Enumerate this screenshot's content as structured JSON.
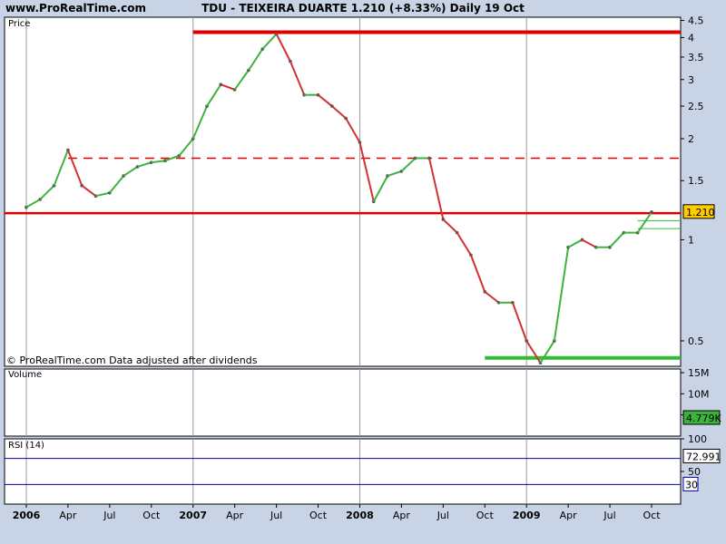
{
  "header": {
    "site": "www.ProRealTime.com",
    "title": "TDU - TEIXEIRA DUARTE    1.210 (+8.33%)   Daily  19 Oct"
  },
  "price_panel": {
    "label": "Price",
    "footnote": "© ProRealTime.com  Data adjusted after dividends",
    "last_price_box": "1.210",
    "y_ticks": [
      "4.5",
      "4",
      "3.5",
      "3",
      "2.5",
      "2",
      "1.5",
      "1",
      "0.5"
    ]
  },
  "volume_panel": {
    "label": "Volume",
    "y_ticks": [
      "15M",
      "10M",
      "5M"
    ],
    "last_volume_box": "4.779K"
  },
  "rsi_panel": {
    "label": "RSI (14)",
    "y_ticks": [
      "100",
      "50"
    ],
    "last_rsi_box": "72.991",
    "lower_level_box": "30"
  },
  "x_axis": {
    "labels": [
      {
        "t": "2006",
        "bold": true
      },
      {
        "t": "Apr",
        "bold": false
      },
      {
        "t": "Jul",
        "bold": false
      },
      {
        "t": "Oct",
        "bold": false
      },
      {
        "t": "2007",
        "bold": true
      },
      {
        "t": "Apr",
        "bold": false
      },
      {
        "t": "Jul",
        "bold": false
      },
      {
        "t": "Oct",
        "bold": false
      },
      {
        "t": "2008",
        "bold": true
      },
      {
        "t": "Apr",
        "bold": false
      },
      {
        "t": "Jul",
        "bold": false
      },
      {
        "t": "Oct",
        "bold": false
      },
      {
        "t": "2009",
        "bold": true
      },
      {
        "t": "Apr",
        "bold": false
      },
      {
        "t": "Jul",
        "bold": false
      },
      {
        "t": "Oct",
        "bold": false
      }
    ]
  },
  "colors": {
    "background": "#c8d4e6",
    "panel": "#ffffff",
    "up": "#3cb43c",
    "down": "#d23232",
    "resistance": "#dd0000",
    "support": "#33bb33",
    "rsi_line": "#000000",
    "rsi_band": "#0000aa",
    "price_box": "#ffcc00"
  },
  "chart_data": {
    "type": "line",
    "title": "TDU - TEIXEIRA DUARTE",
    "y_scale": "log",
    "ylim": [
      0.42,
      4.6
    ],
    "series": [
      {
        "x": [
          "2006-01",
          "2006-02",
          "2006-03",
          "2006-04",
          "2006-05",
          "2006-06",
          "2006-07",
          "2006-08",
          "2006-09",
          "2006-10",
          "2006-11",
          "2006-12",
          "2007-01",
          "2007-02",
          "2007-03",
          "2007-04",
          "2007-05",
          "2007-06",
          "2007-07",
          "2007-08",
          "2007-09",
          "2007-10",
          "2007-11",
          "2007-12",
          "2008-01",
          "2008-02",
          "2008-03",
          "2008-04",
          "2008-05",
          "2008-06",
          "2008-07",
          "2008-08",
          "2008-09",
          "2008-10",
          "2008-11",
          "2008-12",
          "2009-01",
          "2009-02",
          "2009-03",
          "2009-04",
          "2009-05",
          "2009-06",
          "2009-07",
          "2009-08",
          "2009-09",
          "2009-10"
        ],
        "y": [
          1.25,
          1.32,
          1.45,
          1.85,
          1.45,
          1.35,
          1.38,
          1.55,
          1.65,
          1.7,
          1.72,
          1.78,
          2.0,
          2.5,
          2.9,
          2.8,
          3.2,
          3.7,
          4.1,
          3.4,
          2.7,
          2.7,
          2.5,
          2.3,
          1.95,
          1.3,
          1.55,
          1.6,
          1.75,
          1.75,
          1.15,
          1.05,
          0.9,
          0.7,
          0.65,
          0.65,
          0.5,
          0.43,
          0.5,
          0.95,
          1.0,
          0.95,
          0.95,
          1.05,
          1.05,
          1.21
        ]
      }
    ],
    "levels": {
      "resistance_top": 4.15,
      "resistance_dashed": 1.75,
      "resistance_current": 1.2,
      "support": 0.445
    },
    "volume": {
      "unit": "shares",
      "ylim": [
        0,
        15000000
      ],
      "last": 4779
    },
    "rsi": {
      "period": 14,
      "last": 72.991,
      "levels": [
        70,
        30
      ],
      "ylim": [
        0,
        100
      ]
    }
  }
}
